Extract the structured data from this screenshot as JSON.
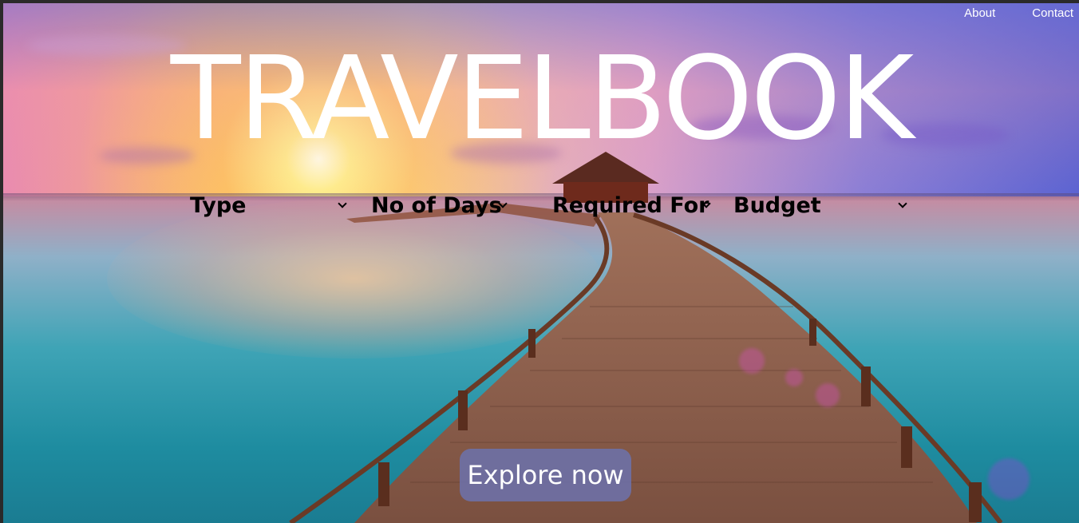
{
  "nav": {
    "about": "About",
    "contact": "Contact"
  },
  "hero": {
    "title": "TRAVELBOOK"
  },
  "filters": [
    {
      "label": "Type",
      "icon": "chevron-down-icon"
    },
    {
      "label": "No of Days",
      "icon": "chevron-down-icon"
    },
    {
      "label": "Required For",
      "icon": "chevron-down-icon"
    },
    {
      "label": "Budget",
      "icon": "chevron-down-icon"
    }
  ],
  "cta": {
    "label": "Explore now"
  },
  "colors": {
    "button_bg": "#6e70a5",
    "title": "#ffffff",
    "filter_text": "#000000"
  }
}
